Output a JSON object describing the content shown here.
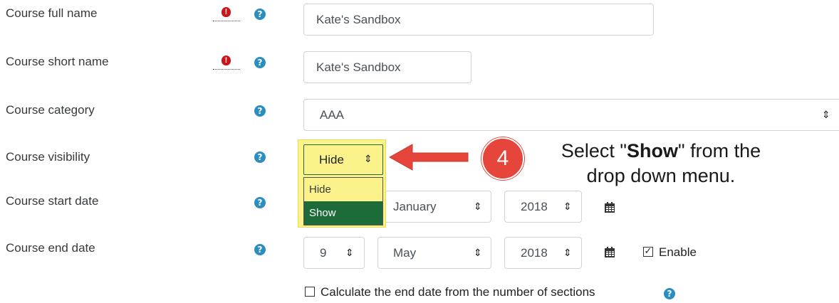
{
  "fields": {
    "full_name": {
      "label": "Course full name",
      "value": "Kate's Sandbox"
    },
    "short_name": {
      "label": "Course short name",
      "value": "Kate's Sandbox"
    },
    "category": {
      "label": "Course category",
      "value": "AAA"
    },
    "visibility": {
      "label": "Course visibility",
      "value": "Hide",
      "options": [
        "Hide",
        "Show"
      ],
      "highlighted_option": "Show"
    },
    "start_date": {
      "label": "Course start date",
      "month": "January",
      "year": "2018"
    },
    "end_date": {
      "label": "Course end date",
      "day": "9",
      "month": "May",
      "year": "2018",
      "enable_label": "Enable",
      "enable_checked": true
    },
    "calc_end": {
      "label": "Calculate the end date from the number of sections",
      "checked": false
    }
  },
  "icons": {
    "required": "exclamation-circle-icon",
    "help": "question-circle-icon",
    "calendar": "calendar-icon",
    "select_caret": "up-down-caret-icon",
    "arrow": "left-arrow-icon"
  },
  "glyphs": {
    "required": "!",
    "help": "?",
    "caret": "⇕",
    "check": "✓"
  },
  "annotation": {
    "step_number": "4",
    "line1_pre": "Select \"",
    "line1_bold": "Show",
    "line1_post": "\" from the",
    "line2": "drop down menu."
  },
  "colors": {
    "help_blue": "#2a8ec1",
    "required_red": "#c9161b",
    "highlight_yellow": "#fbf28c",
    "selected_green": "#1e6b3a",
    "annotation_red": "#e5453a"
  }
}
